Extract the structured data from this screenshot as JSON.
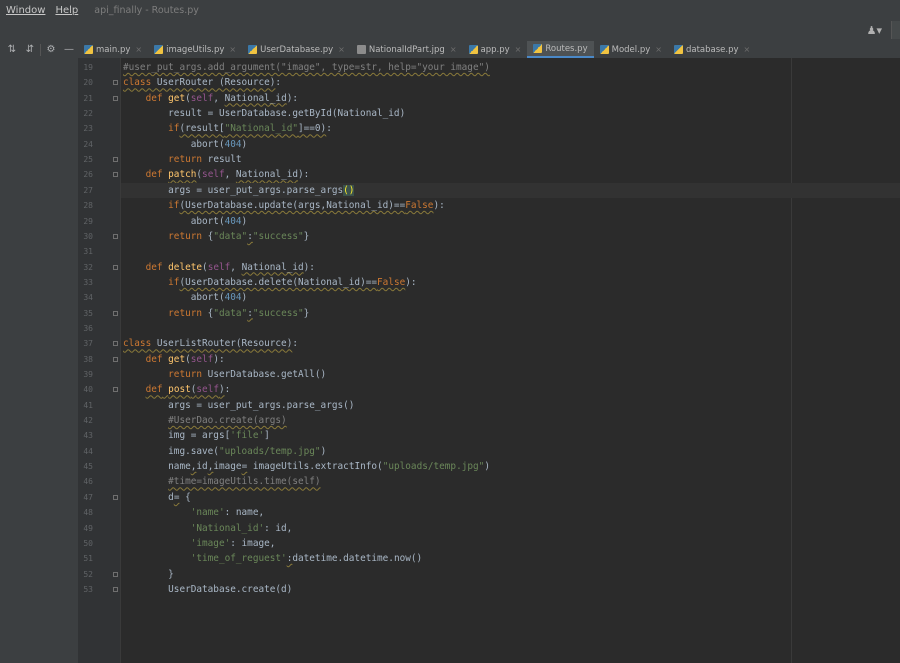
{
  "menu": {
    "window": "Window",
    "help": "Help"
  },
  "window_title": "api_finally - Routes.py",
  "tabs": [
    {
      "label": "main.py",
      "type": "py",
      "active": false
    },
    {
      "label": "imageUtils.py",
      "type": "py",
      "active": false
    },
    {
      "label": "UserDatabase.py",
      "type": "py",
      "active": false
    },
    {
      "label": "NationalIdPart.jpg",
      "type": "img",
      "active": false
    },
    {
      "label": "app.py",
      "type": "py",
      "active": false
    },
    {
      "label": "Routes.py",
      "type": "py",
      "active": true
    },
    {
      "label": "Model.py",
      "type": "py",
      "active": false
    },
    {
      "label": "database.py",
      "type": "py",
      "active": false
    }
  ],
  "editor": {
    "caret_line": 27,
    "lines": [
      {
        "n": 19,
        "tokens": [
          [
            "cm sq",
            "#user_put_args.add_argument(\"image\", type=str, help=\"your image\")"
          ]
        ]
      },
      {
        "n": 20,
        "tokens": [
          [
            "kw sq",
            "class"
          ],
          [
            "sq",
            " UserRouter (Resource)"
          ],
          [
            "",
            ":"
          ]
        ]
      },
      {
        "n": 21,
        "tokens": [
          [
            "",
            "    "
          ],
          [
            "kw",
            "def "
          ],
          [
            "fn",
            "get"
          ],
          [
            "",
            "("
          ],
          [
            "self",
            "self"
          ],
          [
            "",
            ", "
          ],
          [
            "sq",
            "National_id"
          ],
          [
            "",
            "):"
          ]
        ]
      },
      {
        "n": 22,
        "tokens": [
          [
            "",
            "        result = UserDatabase.getById(National_id)"
          ]
        ]
      },
      {
        "n": 23,
        "tokens": [
          [
            "",
            "        "
          ],
          [
            "kw",
            "if"
          ],
          [
            "sq",
            "(result["
          ],
          [
            "str sq",
            "\"National_id\""
          ],
          [
            "sq",
            "]==0)"
          ],
          [
            "",
            ":"
          ]
        ]
      },
      {
        "n": 24,
        "tokens": [
          [
            "",
            "            abort("
          ],
          [
            "num",
            "404"
          ],
          [
            "",
            ")"
          ]
        ]
      },
      {
        "n": 25,
        "tokens": [
          [
            "",
            "        "
          ],
          [
            "kw",
            "return "
          ],
          [
            "",
            "result"
          ]
        ]
      },
      {
        "n": 26,
        "tokens": [
          [
            "",
            "    "
          ],
          [
            "kw",
            "def "
          ],
          [
            "fn sq",
            "patch"
          ],
          [
            "",
            "("
          ],
          [
            "self",
            "self"
          ],
          [
            "",
            ", "
          ],
          [
            "sq",
            "National_id"
          ],
          [
            "",
            "):"
          ]
        ]
      },
      {
        "n": 27,
        "tokens": [
          [
            "",
            "        args = user_put_args.parse_args"
          ],
          [
            "hl",
            "()"
          ]
        ]
      },
      {
        "n": 28,
        "tokens": [
          [
            "",
            "        "
          ],
          [
            "kw",
            "if"
          ],
          [
            "sq",
            "(UserDatabase.update(args,National_id)=="
          ],
          [
            "kw sq",
            "False"
          ],
          [
            "",
            "):"
          ]
        ]
      },
      {
        "n": 29,
        "tokens": [
          [
            "",
            "            abort("
          ],
          [
            "num",
            "404"
          ],
          [
            "",
            ")"
          ]
        ]
      },
      {
        "n": 30,
        "tokens": [
          [
            "",
            "        "
          ],
          [
            "kw",
            "return "
          ],
          [
            "",
            "{"
          ],
          [
            "str",
            "\"data\""
          ],
          [
            "sq",
            ":"
          ],
          [
            "str",
            "\"success\""
          ],
          [
            "",
            "}"
          ]
        ]
      },
      {
        "n": 31,
        "tokens": []
      },
      {
        "n": 32,
        "tokens": [
          [
            "",
            "    "
          ],
          [
            "kw",
            "def "
          ],
          [
            "fn",
            "delete"
          ],
          [
            "",
            "("
          ],
          [
            "self",
            "self"
          ],
          [
            "",
            ", "
          ],
          [
            "sq",
            "National_id"
          ],
          [
            "",
            "):"
          ]
        ]
      },
      {
        "n": 33,
        "tokens": [
          [
            "",
            "        "
          ],
          [
            "kw",
            "if"
          ],
          [
            "sq",
            "(UserDatabase.delete(National_id)=="
          ],
          [
            "kw sq",
            "False"
          ],
          [
            "",
            "):"
          ]
        ]
      },
      {
        "n": 34,
        "tokens": [
          [
            "",
            "            abort("
          ],
          [
            "num",
            "404"
          ],
          [
            "",
            ")"
          ]
        ]
      },
      {
        "n": 35,
        "tokens": [
          [
            "",
            "        "
          ],
          [
            "kw",
            "return "
          ],
          [
            "",
            "{"
          ],
          [
            "str",
            "\"data\""
          ],
          [
            "sq",
            ":"
          ],
          [
            "str",
            "\"success\""
          ],
          [
            "",
            "}"
          ]
        ]
      },
      {
        "n": 36,
        "tokens": []
      },
      {
        "n": 37,
        "tokens": [
          [
            "kw sq",
            "class"
          ],
          [
            "sq",
            " UserListRouter(Resource)"
          ],
          [
            "",
            ":"
          ]
        ]
      },
      {
        "n": 38,
        "tokens": [
          [
            "",
            "    "
          ],
          [
            "kw",
            "def "
          ],
          [
            "fn",
            "get"
          ],
          [
            "",
            "("
          ],
          [
            "self",
            "self"
          ],
          [
            "",
            "):"
          ]
        ]
      },
      {
        "n": 39,
        "tokens": [
          [
            "",
            "        "
          ],
          [
            "kw",
            "return "
          ],
          [
            "",
            "UserDatabase.getAll()"
          ]
        ]
      },
      {
        "n": 40,
        "tokens": [
          [
            "",
            "    "
          ],
          [
            "kw sq",
            "def"
          ],
          [
            "sq",
            " "
          ],
          [
            "fn sq",
            "post"
          ],
          [
            "sq",
            "("
          ],
          [
            "self sq",
            "self"
          ],
          [
            "sq",
            ")"
          ],
          [
            "",
            ":"
          ]
        ]
      },
      {
        "n": 41,
        "tokens": [
          [
            "",
            "        args = user_put_args.parse_args()"
          ]
        ]
      },
      {
        "n": 42,
        "tokens": [
          [
            "",
            "        "
          ],
          [
            "cm sq",
            "#UserDao.create(args)"
          ]
        ]
      },
      {
        "n": 43,
        "tokens": [
          [
            "",
            "        img = args["
          ],
          [
            "str",
            "'file'"
          ],
          [
            "",
            "]"
          ]
        ]
      },
      {
        "n": 44,
        "tokens": [
          [
            "",
            "        img.save("
          ],
          [
            "str",
            "\"uploads/temp.jpg\""
          ],
          [
            "",
            ")"
          ]
        ]
      },
      {
        "n": 45,
        "tokens": [
          [
            "",
            "        name"
          ],
          [
            "sq",
            ","
          ],
          [
            "",
            "id"
          ],
          [
            "sq",
            ","
          ],
          [
            "",
            "image"
          ],
          [
            "sq",
            "="
          ],
          [
            "",
            " imageUtils.extractInfo("
          ],
          [
            "str",
            "\"uploads/temp.jpg\""
          ],
          [
            "",
            ")"
          ]
        ]
      },
      {
        "n": 46,
        "tokens": [
          [
            "",
            "        "
          ],
          [
            "cm sq",
            "#time=imageUtils.time(self)"
          ]
        ]
      },
      {
        "n": 47,
        "tokens": [
          [
            "",
            "        d"
          ],
          [
            "sq",
            "="
          ],
          [
            "",
            " {"
          ]
        ]
      },
      {
        "n": 48,
        "tokens": [
          [
            "",
            "            "
          ],
          [
            "str",
            "'name'"
          ],
          [
            "",
            ": name,"
          ]
        ]
      },
      {
        "n": 49,
        "tokens": [
          [
            "",
            "            "
          ],
          [
            "str",
            "'National_id'"
          ],
          [
            "",
            ": id,"
          ]
        ]
      },
      {
        "n": 50,
        "tokens": [
          [
            "",
            "            "
          ],
          [
            "str",
            "'image'"
          ],
          [
            "",
            ": image,"
          ]
        ]
      },
      {
        "n": 51,
        "tokens": [
          [
            "",
            "            "
          ],
          [
            "str",
            "'time_of_reguest'"
          ],
          [
            "sq",
            ":"
          ],
          [
            "",
            "datetime.datetime.now()"
          ]
        ]
      },
      {
        "n": 52,
        "tokens": [
          [
            "",
            "        }"
          ]
        ]
      },
      {
        "n": 53,
        "tokens": [
          [
            "",
            "        UserDatabase.create(d)"
          ]
        ]
      }
    ]
  }
}
